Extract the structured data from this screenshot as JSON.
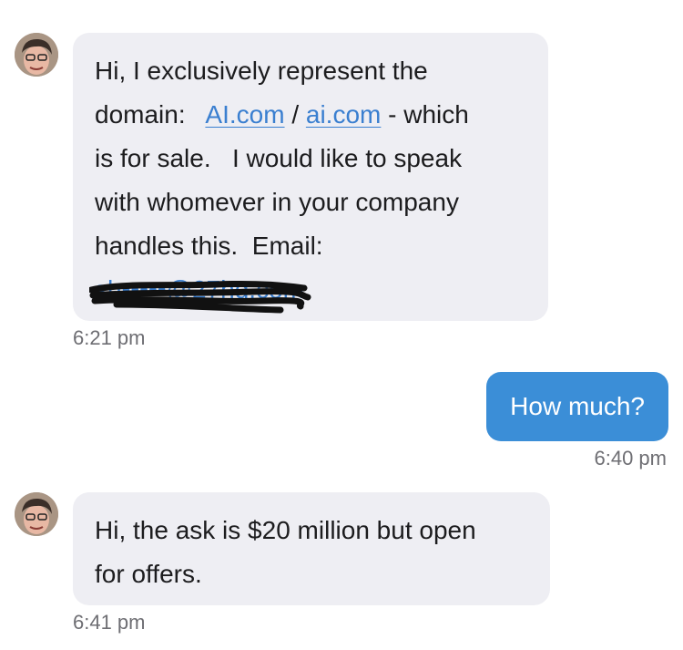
{
  "messages": [
    {
      "direction": "incoming",
      "parts": {
        "line1": "Hi,  I exclusively represent the",
        "domain_prefix": "domain:  ",
        "link1": "AI.com",
        "separator": " / ",
        "link2": "ai.com",
        "line2_suffix": " - which",
        "line3": "is for sale.   I would like to speak",
        "line4": "with whomever in your company",
        "line5": "handles this.  Email:",
        "email_redacted": "sh•••••@27hq.com"
      },
      "time": "6:21 pm"
    },
    {
      "direction": "outgoing",
      "text": "How much?",
      "time": "6:40 pm"
    },
    {
      "direction": "incoming",
      "parts": {
        "line1": "Hi, the ask is $20 million but open",
        "line2": "for offers."
      },
      "time": "6:41 pm"
    }
  ],
  "colors": {
    "incoming_bubble": "#eeeef3",
    "outgoing_bubble": "#3b8ed7",
    "link": "#3a7fd0",
    "timestamp": "#6e6e73"
  },
  "icons": {
    "avatar": "person-avatar-icon",
    "redaction": "redaction-scribble"
  }
}
